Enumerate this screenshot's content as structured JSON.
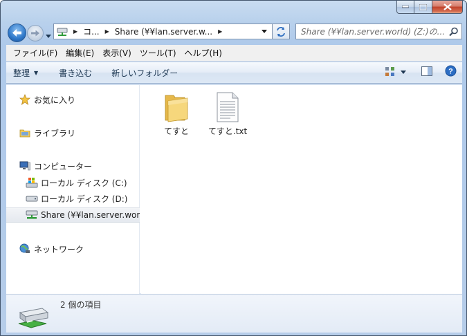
{
  "window": {
    "caption": {
      "minimize": "–",
      "maximize": "□",
      "close": "×"
    }
  },
  "address": {
    "segments": [
      "コ...",
      "Share (¥¥lan.server.w..."
    ],
    "search_placeholder": "Share (¥¥lan.server.world) (Z:)の..."
  },
  "menu": [
    "ファイル(F)",
    "編集(E)",
    "表示(V)",
    "ツール(T)",
    "ヘルプ(H)"
  ],
  "toolbar": {
    "organize": "整理",
    "burn": "書き込む",
    "new_folder": "新しいフォルダー"
  },
  "sidebar": {
    "favorites": "お気に入り",
    "libraries": "ライブラリ",
    "computer": "コンピューター",
    "drives": [
      "ローカル ディスク (C:)",
      "ローカル ディスク (D:)",
      "Share (¥¥lan.server.world) (Z:)"
    ],
    "network": "ネットワーク"
  },
  "files": [
    {
      "name": "てすと",
      "kind": "folder-icon"
    },
    {
      "name": "てすと.txt",
      "kind": "text-file-icon"
    }
  ],
  "details": {
    "count_text": "2 個の項目"
  },
  "colors": {
    "accent": "#2f78c9",
    "selection": "#e5e9ef",
    "folder": "#f2cc60"
  }
}
